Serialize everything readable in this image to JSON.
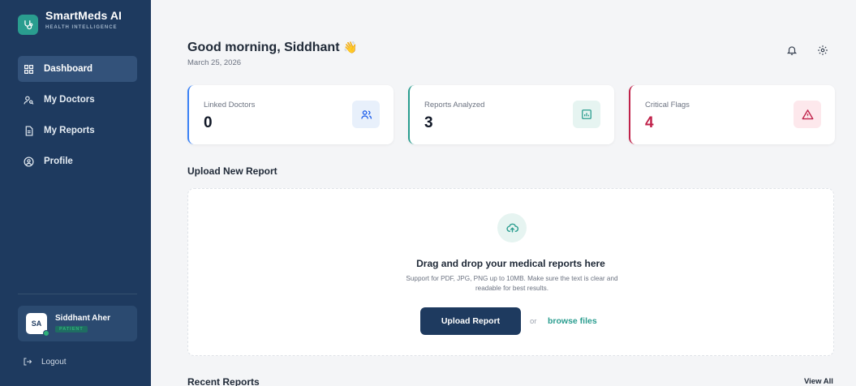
{
  "brand": {
    "name": "SmartMeds AI",
    "subtitle": "HEALTH INTELLIGENCE",
    "icon": "stethoscope-icon"
  },
  "sidebar": {
    "items": [
      {
        "label": "Dashboard",
        "icon": "dashboard-icon",
        "active": true
      },
      {
        "label": "My Doctors",
        "icon": "doctors-icon",
        "active": false
      },
      {
        "label": "My Reports",
        "icon": "document-icon",
        "active": false
      },
      {
        "label": "Profile",
        "icon": "profile-icon",
        "active": false
      }
    ],
    "user": {
      "initials": "SA",
      "name": "Siddhant Aher",
      "role": "PATIENT",
      "status_color": "#2fb07a"
    },
    "logout_label": "Logout"
  },
  "header": {
    "greeting": "Good morning, Siddhant",
    "wave": "👋",
    "date": "March 25, 2026",
    "icons": [
      "bell-icon",
      "settings-icon"
    ]
  },
  "stats": [
    {
      "label": "Linked Doctors",
      "value": "0",
      "accent": "#3b82f6",
      "icon": "users-icon",
      "icon_bg": "#e8f0fb",
      "value_color": "#111827"
    },
    {
      "label": "Reports Analyzed",
      "value": "3",
      "accent": "#2a9d8f",
      "icon": "chart-icon",
      "icon_bg": "#e6f4f1",
      "value_color": "#111827"
    },
    {
      "label": "Critical Flags",
      "value": "4",
      "accent": "#c0224a",
      "icon": "warning-icon",
      "icon_bg": "#fde8ec",
      "value_color": "#c0224a"
    }
  ],
  "upload": {
    "section_title": "Upload New Report",
    "title": "Drag and drop your medical reports here",
    "subtitle": "Support for PDF, JPG, PNG up to 10MB. Make sure the text is clear and readable for best results.",
    "button_label": "Upload Report",
    "or_label": "or",
    "browse_label": "browse files"
  },
  "recent": {
    "title": "Recent Reports",
    "view_all_label": "View All"
  },
  "colors": {
    "sidebar": "#1e3a5f",
    "accent": "#2a9d8f",
    "background": "#f4f5f7"
  }
}
